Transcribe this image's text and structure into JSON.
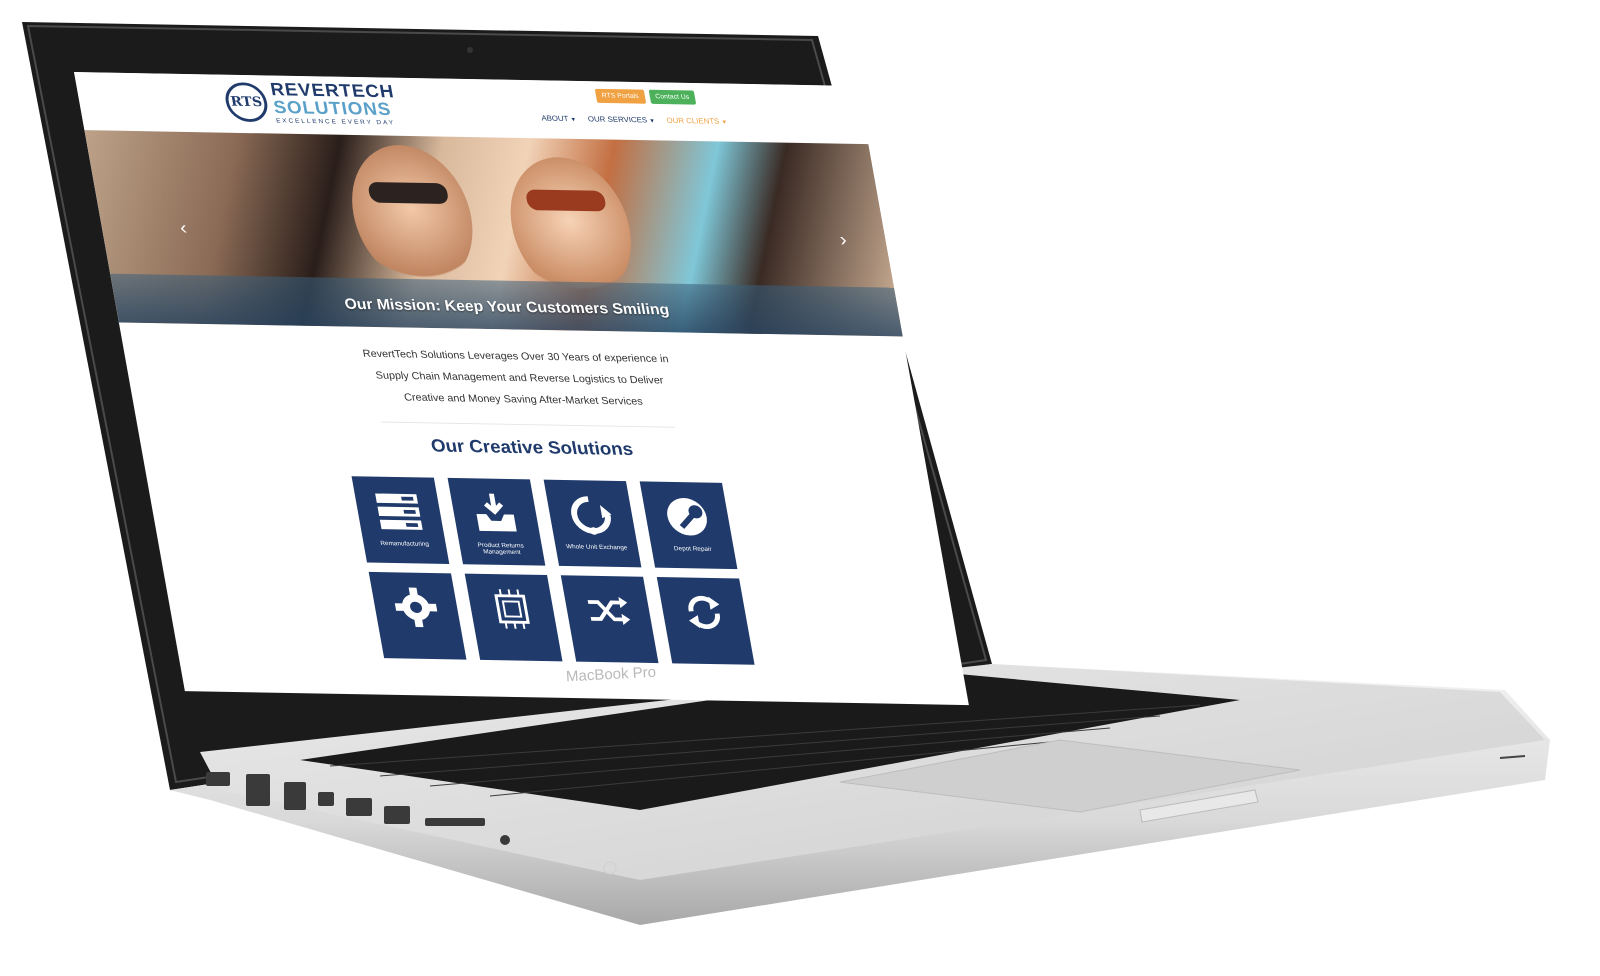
{
  "device": {
    "label": "MacBook Pro"
  },
  "site": {
    "logo": {
      "mark": "RTS",
      "line1": "REVERTECH",
      "line2": "SOLUTIONS",
      "tagline": "EXCELLENCE EVERY DAY"
    },
    "top_buttons": {
      "portals": "RTS Portals",
      "contact": "Contact Us"
    },
    "nav": [
      {
        "label": "ABOUT",
        "active": false
      },
      {
        "label": "OUR SERVICES",
        "active": false
      },
      {
        "label": "OUR CLIENTS",
        "active": true
      }
    ],
    "hero": {
      "caption": "Our Mission: Keep Your Customers Smiling",
      "prev": "‹",
      "next": "›"
    },
    "intro": "RevertTech Solutions Leverages Over 30 Years of experience in Supply Chain Management and Reverse Logistics to Deliver Creative and Money Saving After-Market Services",
    "solutions_title": "Our Creative Solutions",
    "solutions": [
      {
        "label": "Remanufacturing",
        "icon": "server-icon"
      },
      {
        "label": "Product Returns Management",
        "icon": "inbox-download-icon"
      },
      {
        "label": "Whole Unit Exchange",
        "icon": "refresh-circle-icon"
      },
      {
        "label": "Depot Repair",
        "icon": "wrench-icon"
      },
      {
        "label": "",
        "icon": "gear-icon"
      },
      {
        "label": "",
        "icon": "chip-icon"
      },
      {
        "label": "",
        "icon": "shuffle-icon"
      },
      {
        "label": "",
        "icon": "sync-icon"
      }
    ],
    "colors": {
      "navy": "#1f3a6b",
      "light_blue": "#5aa0c8",
      "orange": "#f0a142",
      "green": "#4cb15a"
    }
  }
}
